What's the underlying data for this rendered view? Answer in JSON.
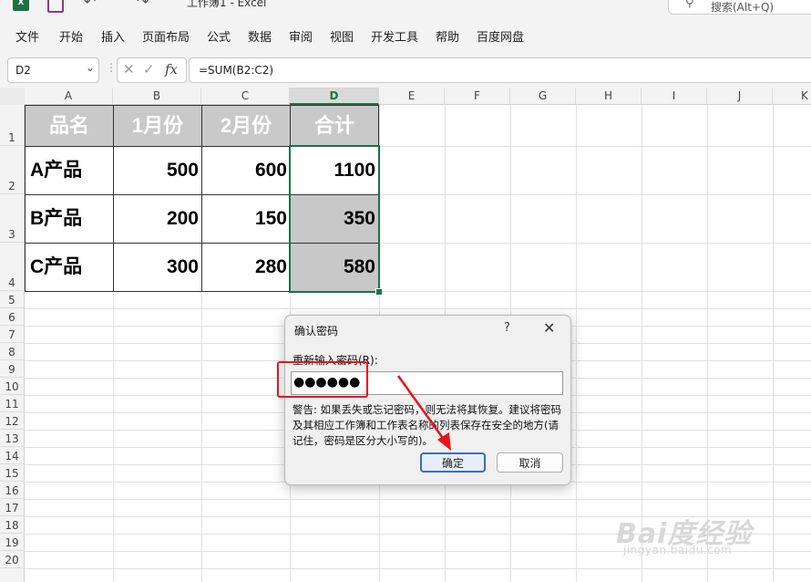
{
  "window": {
    "title": "工作簿1 - Excel",
    "search_label": "搜索(Alt+Q)"
  },
  "menu": [
    "文件",
    "开始",
    "插入",
    "页面布局",
    "公式",
    "数据",
    "审阅",
    "视图",
    "开发工具",
    "帮助",
    "百度网盘"
  ],
  "formula_bar": {
    "name_box": "D2",
    "fx_label": "fx",
    "formula": "=SUM(B2:C2)"
  },
  "sheet": {
    "columns": [
      "A",
      "B",
      "C",
      "D",
      "E",
      "F",
      "G",
      "H",
      "I",
      "J",
      "K"
    ],
    "rows": [
      "1",
      "2",
      "3",
      "4",
      "5",
      "6",
      "7",
      "8",
      "9",
      "10",
      "11",
      "12",
      "13",
      "14",
      "15",
      "16",
      "17",
      "18",
      "19",
      "20"
    ],
    "selected_column": "D",
    "table": {
      "headers": [
        "品名",
        "1月份",
        "2月份",
        "合计"
      ],
      "rows": [
        [
          "A产品",
          "500",
          "600",
          "1100"
        ],
        [
          "B产品",
          "200",
          "150",
          "350"
        ],
        [
          "C产品",
          "300",
          "280",
          "580"
        ]
      ]
    }
  },
  "dialog": {
    "title": "确认密码",
    "help": "?",
    "close": "✕",
    "label": "重新输入密码(R):",
    "password_mask": "●●●●●●",
    "warning": "警告: 如果丢失或忘记密码，则无法将其恢复。建议将密码及其相应工作簿和工作表名称的列表保存在安全的地方(请记住，密码是区分大小写的)。",
    "ok": "确定",
    "cancel": "取消"
  },
  "watermark": {
    "main": "Bai度经验",
    "sub": "jingyan.baidu.com"
  },
  "colors": {
    "excel_green": "#1e7145",
    "annotation_red": "#e8141b",
    "header_fill": "#c9c9c9"
  }
}
